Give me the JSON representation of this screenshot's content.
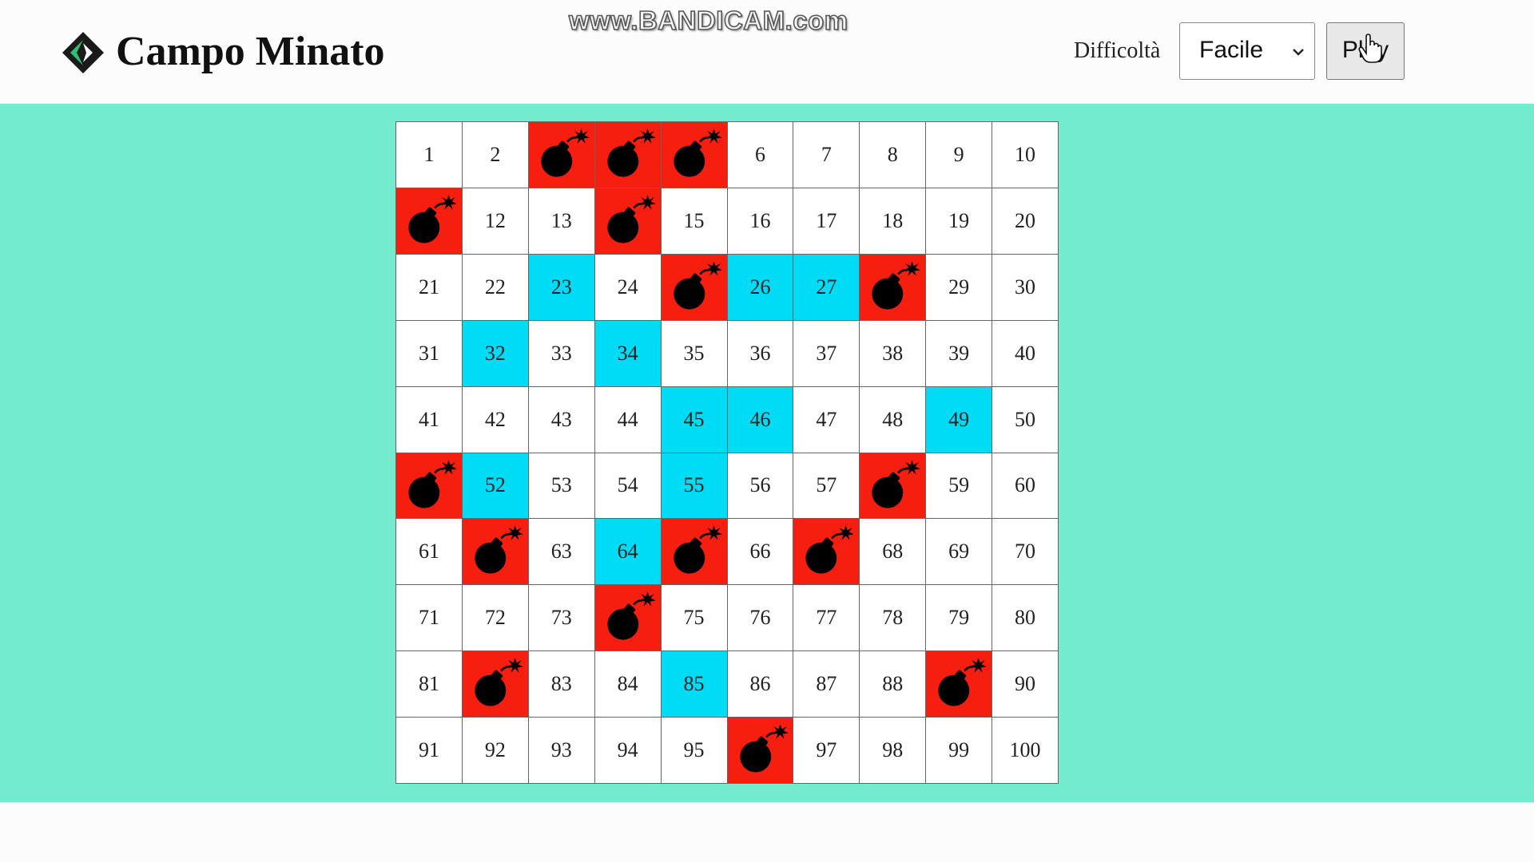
{
  "watermark": "www.BANDICAM.com",
  "app": {
    "title": "Campo Minato",
    "logo_icon": "diamond-chevron-icon"
  },
  "controls": {
    "difficulty_label": "Difficoltà",
    "difficulty_value": "Facile",
    "play_label": "Play"
  },
  "colors": {
    "background": "#73ebcf",
    "safe_revealed": "#00dcf5",
    "bomb": "#f51e0f",
    "cell": "#ffffff"
  },
  "board": {
    "rows": 10,
    "cols": 10,
    "bombs": [
      3,
      4,
      5,
      11,
      14,
      25,
      28,
      51,
      58,
      62,
      65,
      67,
      74,
      82,
      89,
      96
    ],
    "revealed_safe": [
      23,
      26,
      27,
      32,
      34,
      45,
      46,
      49,
      52,
      55,
      64,
      85
    ]
  }
}
